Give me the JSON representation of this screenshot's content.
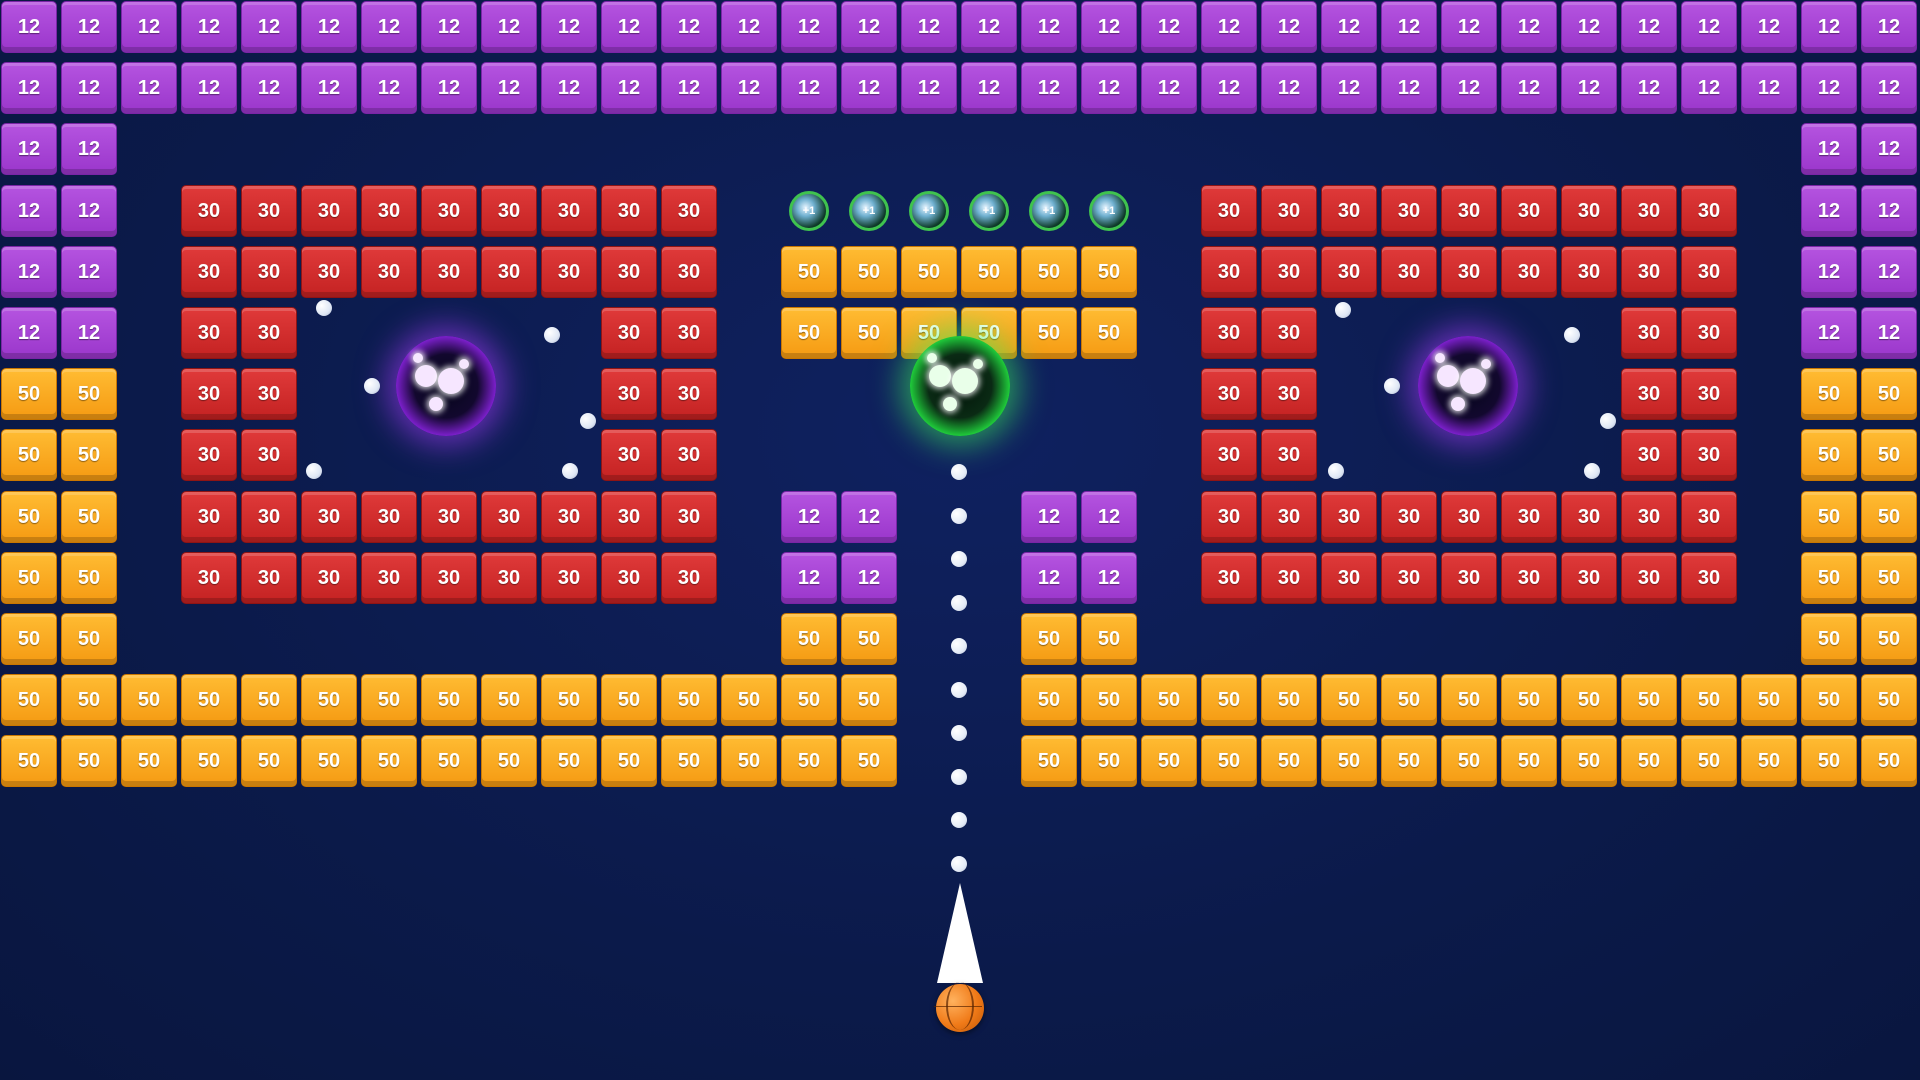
{
  "game": {
    "type": "brick breaker",
    "palette": {
      "background": "#0b1a4a",
      "brick_12": "#a944d8",
      "brick_30": "#d12b2b",
      "brick_50": "#f7a91e",
      "portal_purple": "#a23df0",
      "portal_green": "#32d14a",
      "launcher_ball": "#f07a18"
    },
    "brick_labels": {
      "purple": "12",
      "red": "30",
      "orange": "50"
    },
    "ring_label": "+1",
    "bricks": [
      {
        "row": 0,
        "cols": [
          0,
          1,
          2,
          3,
          4,
          5,
          6,
          7,
          8,
          9,
          10,
          11,
          12,
          13,
          14,
          15,
          16,
          17,
          18,
          19,
          20,
          21,
          22,
          23,
          24,
          25,
          26,
          27,
          28,
          29,
          30,
          31
        ],
        "type": "12"
      },
      {
        "row": 1,
        "cols": [
          0,
          1,
          2,
          3,
          4,
          5,
          6,
          7,
          8,
          9,
          10,
          11,
          12,
          13,
          14,
          15,
          16,
          17,
          18,
          19,
          20,
          21,
          22,
          23,
          24,
          25,
          26,
          27,
          28,
          29,
          30,
          31
        ],
        "type": "12"
      },
      {
        "row": 2,
        "cols": [
          0,
          1,
          30,
          31
        ],
        "type": "12"
      },
      {
        "row": 3,
        "cols": [
          0,
          1,
          30,
          31
        ],
        "type": "12"
      },
      {
        "row": 3,
        "cols": [
          3,
          4,
          5,
          6,
          7,
          8,
          9,
          10,
          11,
          20,
          21,
          22,
          23,
          24,
          25,
          26,
          27,
          28
        ],
        "type": "30"
      },
      {
        "row": 4,
        "cols": [
          0,
          1,
          30,
          31
        ],
        "type": "12"
      },
      {
        "row": 4,
        "cols": [
          3,
          4,
          5,
          6,
          7,
          8,
          9,
          10,
          11,
          20,
          21,
          22,
          23,
          24,
          25,
          26,
          27,
          28
        ],
        "type": "30"
      },
      {
        "row": 4,
        "cols": [
          13,
          14,
          15,
          16,
          17,
          18
        ],
        "type": "50"
      },
      {
        "row": 5,
        "cols": [
          0,
          1,
          30,
          31
        ],
        "type": "12"
      },
      {
        "row": 5,
        "cols": [
          3,
          4,
          10,
          11,
          20,
          21,
          27,
          28
        ],
        "type": "30"
      },
      {
        "row": 5,
        "cols": [
          13,
          14,
          15,
          16,
          17,
          18
        ],
        "type": "50"
      },
      {
        "row": 6,
        "cols": [
          0,
          1,
          30,
          31
        ],
        "type": "50"
      },
      {
        "row": 6,
        "cols": [
          3,
          4,
          10,
          11,
          20,
          21,
          27,
          28
        ],
        "type": "30"
      },
      {
        "row": 7,
        "cols": [
          0,
          1,
          30,
          31
        ],
        "type": "50"
      },
      {
        "row": 7,
        "cols": [
          3,
          4,
          10,
          11,
          20,
          21,
          27,
          28
        ],
        "type": "30"
      },
      {
        "row": 8,
        "cols": [
          0,
          1,
          30,
          31
        ],
        "type": "50"
      },
      {
        "row": 8,
        "cols": [
          3,
          4,
          5,
          6,
          7,
          8,
          9,
          10,
          11,
          20,
          21,
          22,
          23,
          24,
          25,
          26,
          27,
          28
        ],
        "type": "30"
      },
      {
        "row": 8,
        "cols": [
          13,
          14,
          17,
          18
        ],
        "type": "12"
      },
      {
        "row": 9,
        "cols": [
          0,
          1,
          30,
          31
        ],
        "type": "50"
      },
      {
        "row": 9,
        "cols": [
          3,
          4,
          5,
          6,
          7,
          8,
          9,
          10,
          11,
          20,
          21,
          22,
          23,
          24,
          25,
          26,
          27,
          28
        ],
        "type": "30"
      },
      {
        "row": 9,
        "cols": [
          13,
          14,
          17,
          18
        ],
        "type": "12"
      },
      {
        "row": 10,
        "cols": [
          0,
          1,
          13,
          14,
          17,
          18,
          30,
          31
        ],
        "type": "50"
      },
      {
        "row": 11,
        "cols": [
          0,
          1,
          2,
          3,
          4,
          5,
          6,
          7,
          8,
          9,
          10,
          11,
          12,
          13,
          14,
          17,
          18,
          19,
          20,
          21,
          22,
          23,
          24,
          25,
          26,
          27,
          28,
          29,
          30,
          31
        ],
        "type": "50"
      },
      {
        "row": 12,
        "cols": [
          0,
          1,
          2,
          3,
          4,
          5,
          6,
          7,
          8,
          9,
          10,
          11,
          12,
          13,
          14,
          17,
          18,
          19,
          20,
          21,
          22,
          23,
          24,
          25,
          26,
          27,
          28,
          29,
          30,
          31
        ],
        "type": "50"
      }
    ],
    "rings": {
      "row": 3,
      "cols": [
        13,
        14,
        15,
        16,
        17,
        18
      ]
    },
    "portals": [
      {
        "name": "left-portal",
        "color": "purple"
      },
      {
        "name": "center-portal",
        "color": "green"
      },
      {
        "name": "right-portal",
        "color": "purple"
      }
    ],
    "aim_dots": 10
  }
}
